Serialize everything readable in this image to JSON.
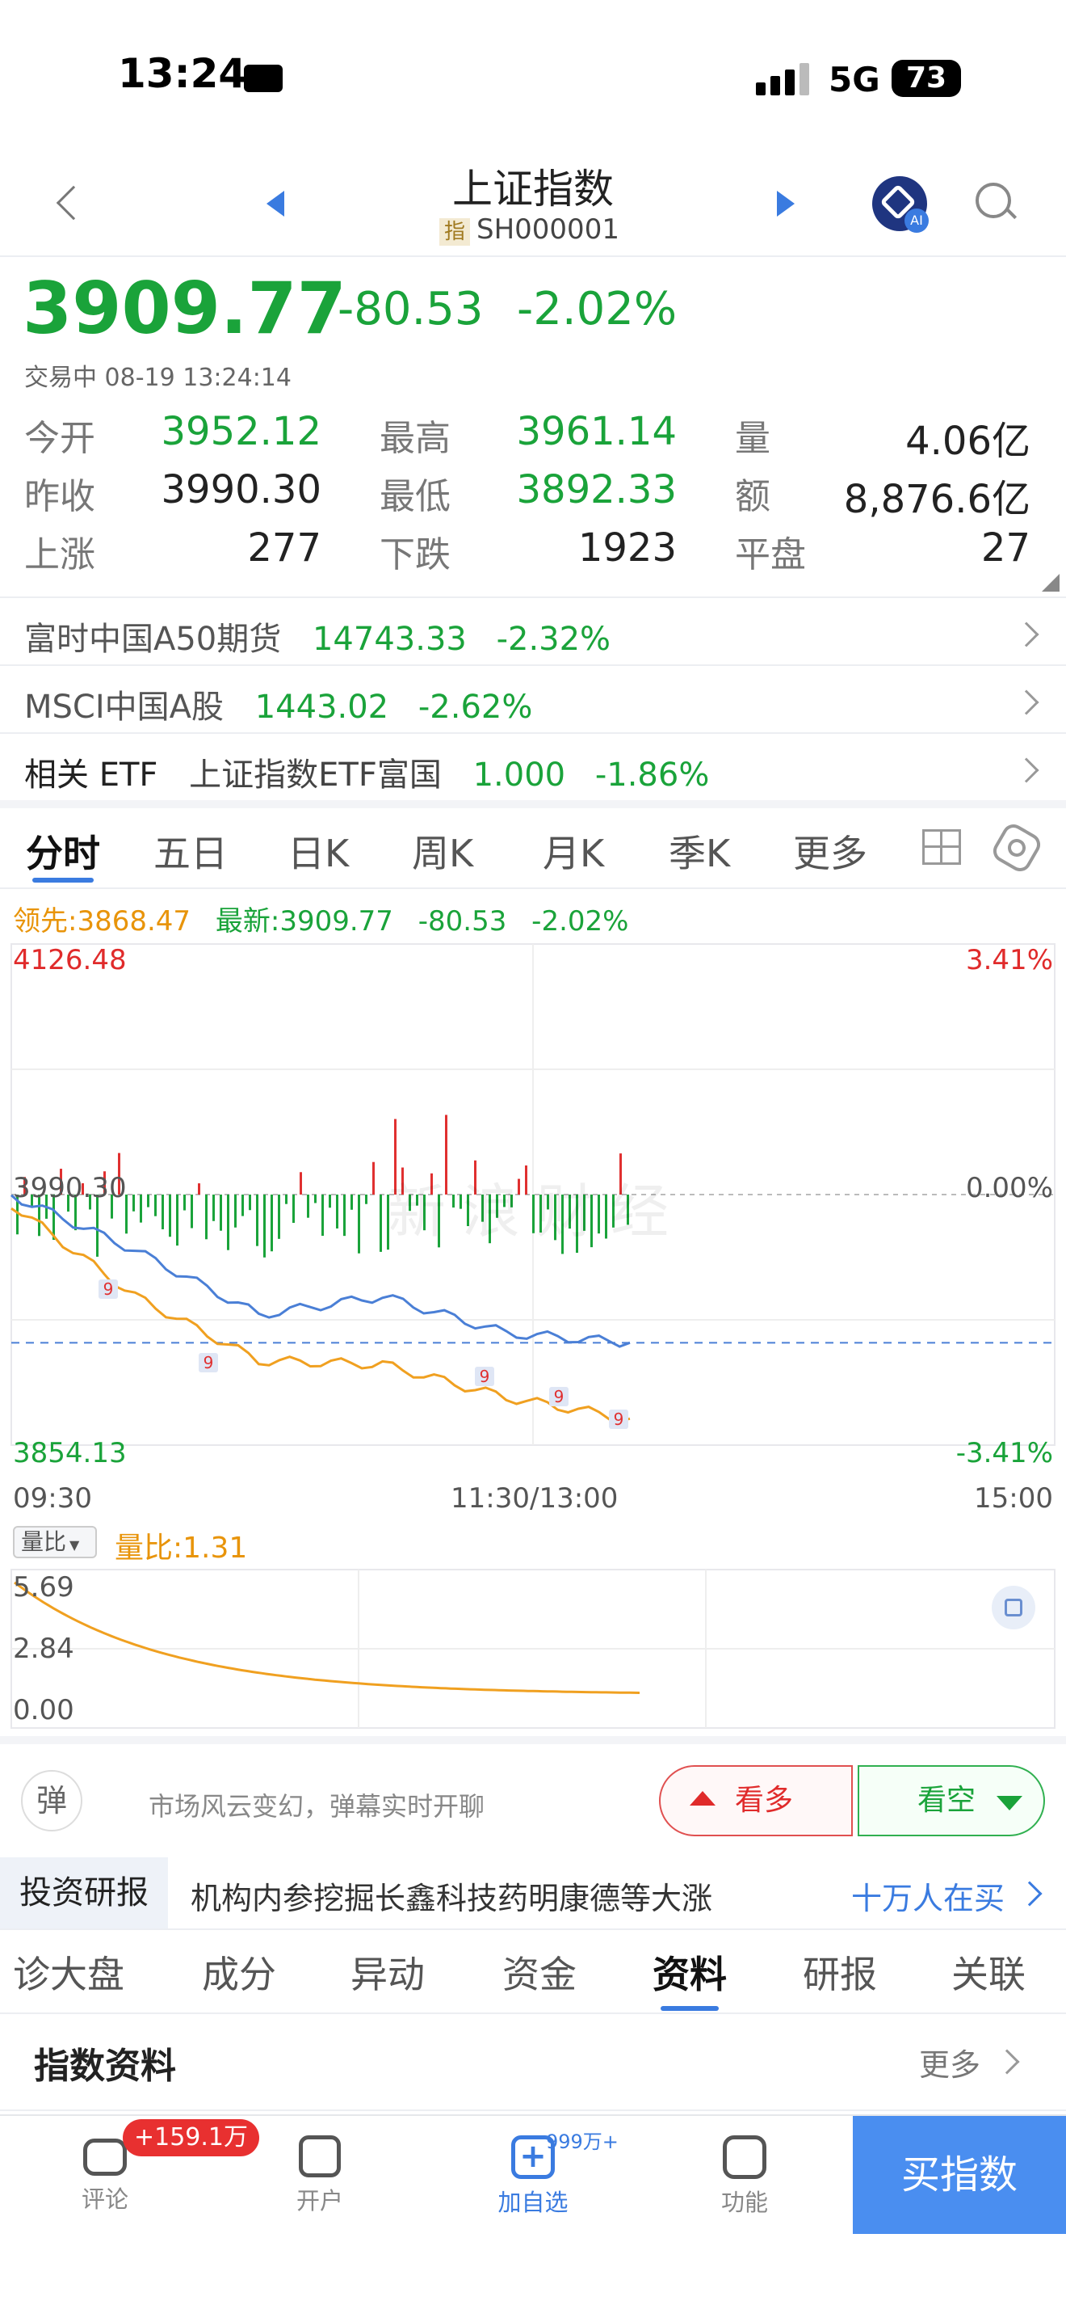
{
  "status_bar": {
    "time": "13:24",
    "network": "5G",
    "battery": "73"
  },
  "header": {
    "title": "上证指数",
    "code_tag": "指",
    "code": "SH000001"
  },
  "quote": {
    "price": "3909.77",
    "change": "-80.53",
    "change_pct": "-2.02%",
    "status": "交易中 08-19 13:24:14"
  },
  "stats": [
    {
      "label": "今开",
      "value": "3952.12",
      "color": "green"
    },
    {
      "label": "最高",
      "value": "3961.14",
      "color": "green"
    },
    {
      "label": "量",
      "value": "4.06亿",
      "color": "black"
    },
    {
      "label": "昨收",
      "value": "3990.30",
      "color": "black"
    },
    {
      "label": "最低",
      "value": "3892.33",
      "color": "green"
    },
    {
      "label": "额",
      "value": "8,876.6亿",
      "color": "black"
    },
    {
      "label": "上涨",
      "value": "277",
      "color": "black"
    },
    {
      "label": "下跌",
      "value": "1923",
      "color": "black"
    },
    {
      "label": "平盘",
      "value": "27",
      "color": "black"
    }
  ],
  "related": [
    {
      "name": "富时中国A50期货",
      "value": "14743.33",
      "pct": "-2.32%"
    },
    {
      "name": "MSCI中国A股",
      "value": "1443.02",
      "pct": "-2.62%"
    },
    {
      "name": "相关 ETF",
      "sub": "上证指数ETF富国",
      "value": "1.000",
      "pct": "-1.86%"
    }
  ],
  "chart_tabs": [
    "分时",
    "五日",
    "日K",
    "周K",
    "月K",
    "季K",
    "更多"
  ],
  "chart_legend": {
    "lead": "领先:3868.47",
    "latest": "最新:3909.77",
    "change": "-80.53",
    "pct": "-2.02%"
  },
  "chart_labels": {
    "ymax": "4126.48",
    "ymid": "3990.30",
    "ymin": "3854.13",
    "pmax": "3.41%",
    "pmid": "0.00%",
    "pmin": "-3.41%",
    "t_start": "09:30",
    "t_mid": "11:30/13:00",
    "t_end": "15:00",
    "watermark": "新浪财经"
  },
  "vol_ratio": {
    "selector": "量比",
    "value": "量比:1.31",
    "ticks": [
      "5.69",
      "2.84",
      "0.00"
    ]
  },
  "danmu": {
    "placeholder": "市场风云变幻，弹幕实时开聊",
    "bull": "看多",
    "bear": "看空",
    "icon_text": "弹"
  },
  "research": {
    "tag": "投资研报",
    "text": "机构内参挖掘长鑫科技药明康德等大涨",
    "link": "十万人在买"
  },
  "bottom_tabs": [
    "诊大盘",
    "成分",
    "异动",
    "资金",
    "资料",
    "研报",
    "关联"
  ],
  "active_bottom_tab": 4,
  "index_info": {
    "title": "指数资料",
    "more": "更多"
  },
  "nav": {
    "comment": "评论",
    "comment_badge": "+159.1万",
    "open": "开户",
    "watch": "加自选",
    "watch_badge": "999万+",
    "func": "功能",
    "buy": "买指数"
  },
  "chart_data": {
    "type": "line",
    "x": [
      "09:30",
      "10:00",
      "10:30",
      "11:00",
      "11:30/13:00",
      "13:24"
    ],
    "ylim": [
      3854.13,
      4126.48
    ],
    "series": [
      {
        "name": "最新",
        "values": [
          3990,
          3960,
          3925,
          3935,
          3915,
          3909.77
        ]
      },
      {
        "name": "领先",
        "values": [
          3985,
          3935,
          3900,
          3898,
          3880,
          3868.47
        ]
      }
    ]
  }
}
